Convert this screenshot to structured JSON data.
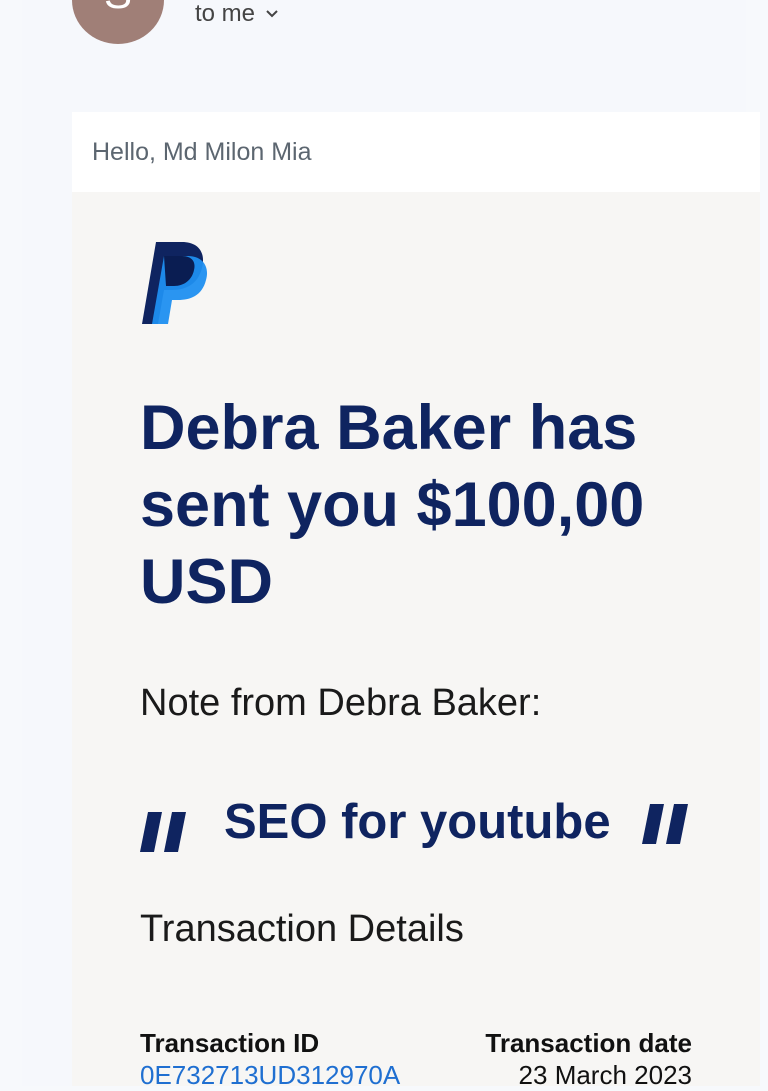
{
  "header": {
    "avatar_initial": "S",
    "recipient": "to me"
  },
  "greeting": "Hello, Md Milon Mia",
  "email": {
    "headline": "Debra Baker has sent you $100,00 USD",
    "note_label": "Note from Debra Baker:",
    "note_text": "SEO for youtube",
    "transaction_section_title": "Transaction Details",
    "transaction": {
      "id_label": "Transaction ID",
      "id_value": "0E732713UD312970A",
      "date_label": "Transaction date",
      "date_value": "23 March 2023"
    }
  },
  "colors": {
    "brand_dark": "#0f2460",
    "brand_blue": "#1f6fd1",
    "avatar": "#a07f77"
  },
  "icons": {
    "logo": "paypal-logo",
    "open_quote": "open-quote-icon",
    "close_quote": "close-quote-icon",
    "chevron": "chevron-down-icon"
  }
}
